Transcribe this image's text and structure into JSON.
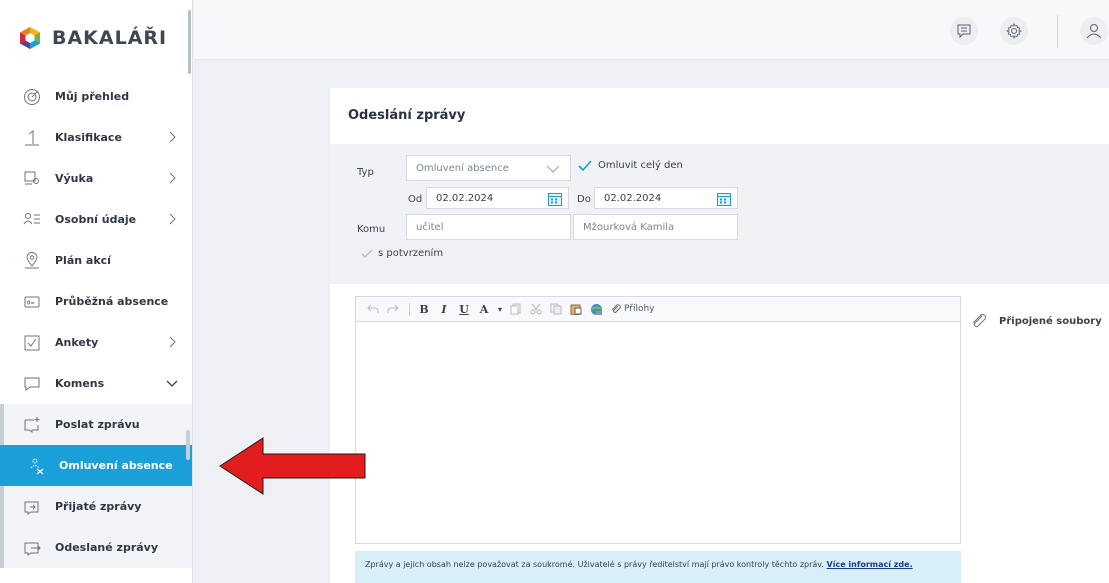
{
  "app": {
    "logo_text": "BAKALÁŘI"
  },
  "sidebar": {
    "items": [
      {
        "label": "Můj přehled",
        "icon": "target-icon",
        "chevron": ""
      },
      {
        "label": "Klasifikace",
        "icon": "grade-one-icon",
        "chevron": "right"
      },
      {
        "label": "Výuka",
        "icon": "lesson-icon",
        "chevron": "right"
      },
      {
        "label": "Osobní údaje",
        "icon": "person-list-icon",
        "chevron": "right"
      },
      {
        "label": "Plán akcí",
        "icon": "map-pin-icon",
        "chevron": ""
      },
      {
        "label": "Průběžná absence",
        "icon": "absence-card-icon",
        "chevron": ""
      },
      {
        "label": "Ankety",
        "icon": "checkbox-icon",
        "chevron": "right"
      },
      {
        "label": "Komens",
        "icon": "chat-icon",
        "chevron": "down"
      }
    ],
    "sub_items": [
      {
        "label": "Poslat zprávu",
        "icon": "send-message-icon",
        "active": false
      },
      {
        "label": "Omluvení absence",
        "icon": "excuse-absence-icon",
        "active": true
      },
      {
        "label": "Přijaté zprávy",
        "icon": "received-messages-icon",
        "active": false
      },
      {
        "label": "Odeslané zprávy",
        "icon": "sent-messages-icon",
        "active": false
      }
    ]
  },
  "topbar": {
    "icons": [
      "message-icon",
      "gear-icon",
      "user-icon"
    ]
  },
  "form": {
    "title": "Odeslání zprávy",
    "typ_label": "Typ",
    "typ_value": "Omluvení absence",
    "whole_day_label": "Omluvit celý den",
    "whole_day_checked": true,
    "od_label": "Od",
    "od_value": "02.02.2024",
    "do_label": "Do",
    "do_value": "02.02.2024",
    "komu_label": "Komu",
    "komu_type": "učitel",
    "komu_name": "Mžourková Kamila",
    "confirm_label": "s potvrzením",
    "confirm_checked": true
  },
  "editor": {
    "attachments_button": "Přílohy",
    "attached_files_label": "Připojené soubory"
  },
  "notice": {
    "text": "Zprávy a jejich obsah nelze považovat za soukromé. Uživatelé s právy ředitelství mají právo kontroly těchto zpráv. ",
    "link": "Více informací zde."
  },
  "colors": {
    "accent": "#1b9fd8",
    "arrow": "#e31d1d"
  }
}
